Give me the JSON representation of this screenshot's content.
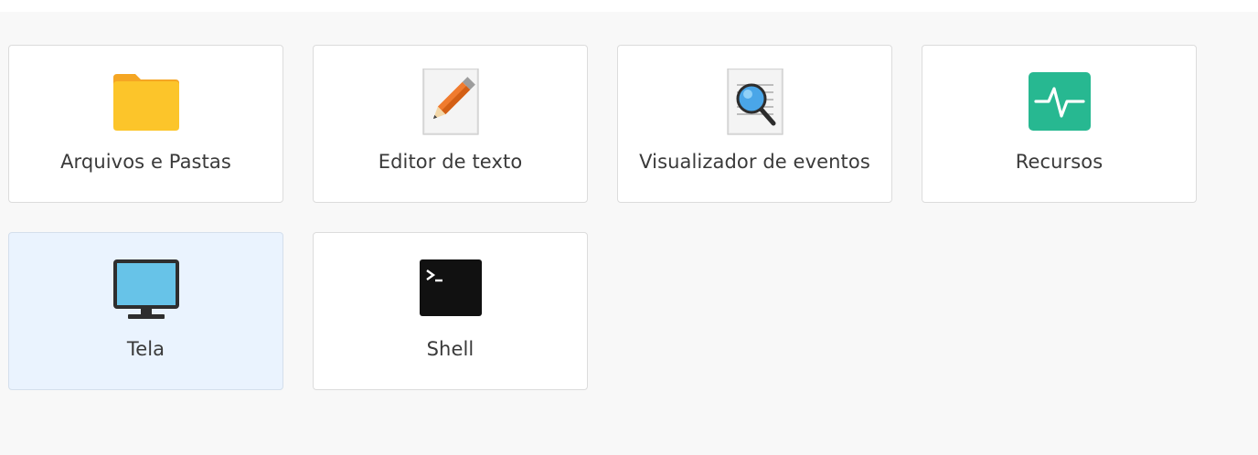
{
  "apps": [
    {
      "label": "Arquivos e Pastas",
      "icon": "folder-icon"
    },
    {
      "label": "Editor de texto",
      "icon": "pencil-icon"
    },
    {
      "label": "Visualizador de eventos",
      "icon": "magnifier-log-icon"
    },
    {
      "label": "Recursos",
      "icon": "activity-monitor-icon"
    },
    {
      "label": "Tela",
      "icon": "monitor-icon"
    },
    {
      "label": "Shell",
      "icon": "terminal-icon"
    }
  ],
  "selected": "Tela",
  "colors": {
    "folder": "#fcc52a",
    "resources": "#27b891",
    "monitor_screen": "#67c3e8",
    "selected_bg": "#eaf3fe"
  }
}
